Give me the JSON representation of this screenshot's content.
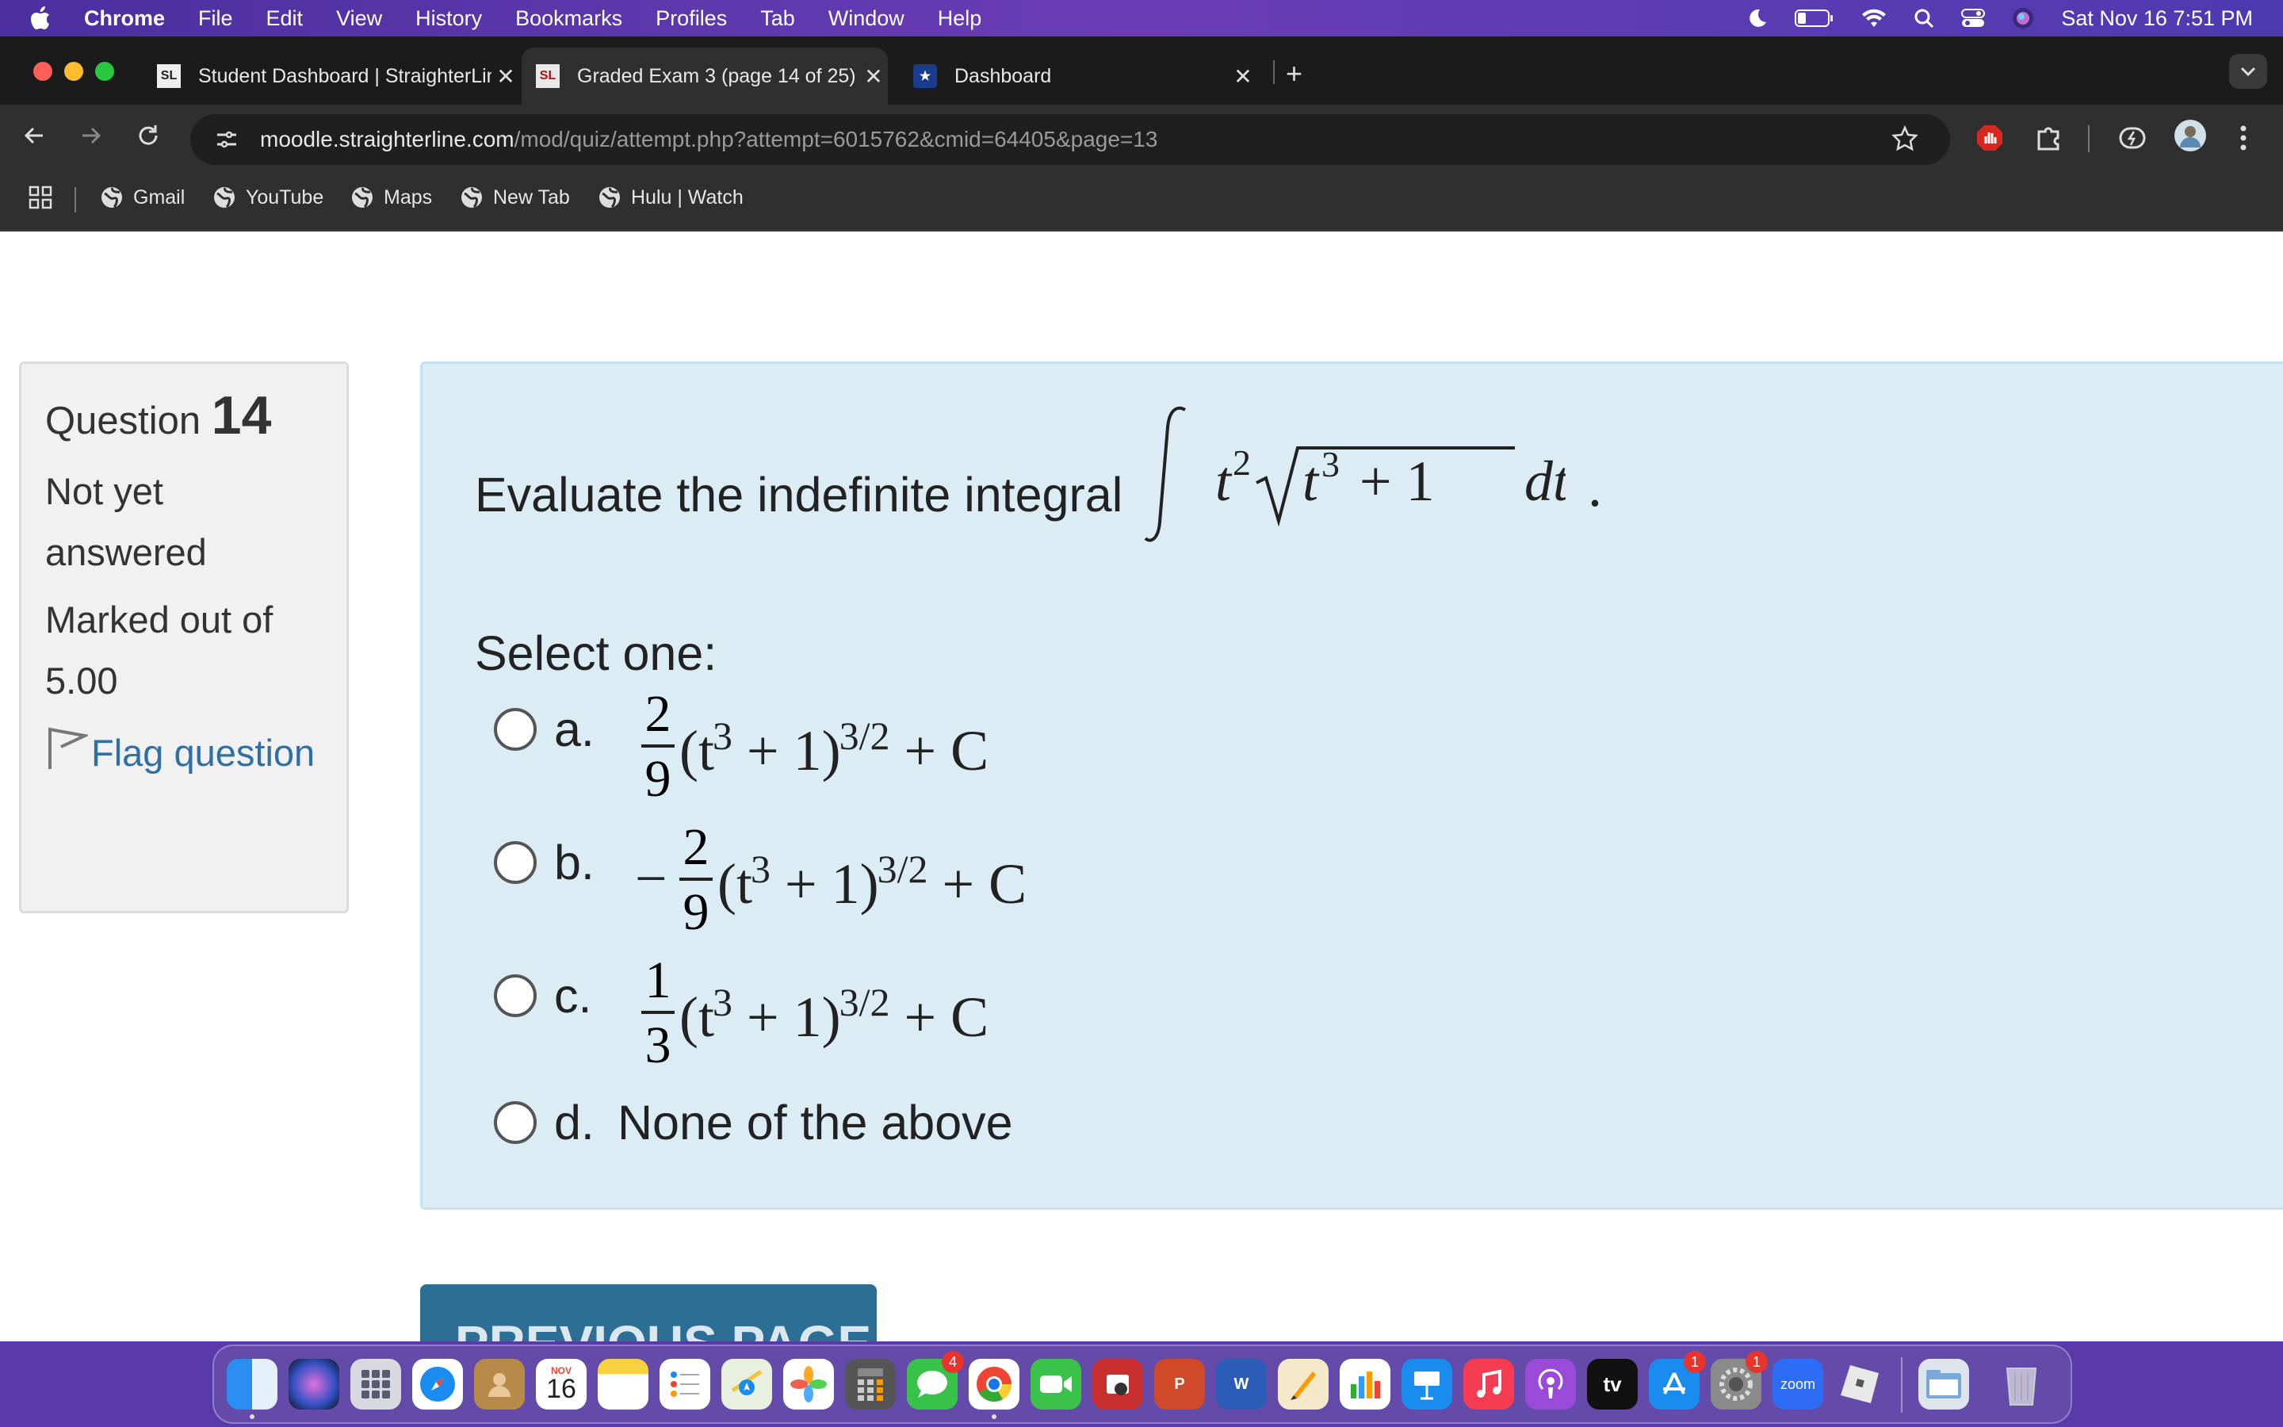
{
  "menubar": {
    "app_name": "Chrome",
    "menus": [
      "File",
      "Edit",
      "View",
      "History",
      "Bookmarks",
      "Profiles",
      "Tab",
      "Window",
      "Help"
    ],
    "datetime": "Sat Nov 16  7:51 PM"
  },
  "tabs": [
    {
      "favicon": "SL",
      "title": "Student Dashboard | StraighterLine",
      "active": false
    },
    {
      "favicon": "SL",
      "title": "Graded Exam 3 (page 14 of 25)",
      "active": true
    },
    {
      "favicon": "★",
      "title": "Dashboard",
      "active": false
    }
  ],
  "address_bar": {
    "domain": "moodle.straighterline.com",
    "path": "/mod/quiz/attempt.php?attempt=6015762&cmid=64405&page=13"
  },
  "bookmarks": [
    "Gmail",
    "YouTube",
    "Maps",
    "New Tab",
    "Hulu | Watch"
  ],
  "question_info": {
    "label": "Question",
    "number": "14",
    "state": "Not yet answered",
    "marks": "Marked out of 5.00",
    "flag_label": "Flag question"
  },
  "question": {
    "prompt": "Evaluate the indefinite integral",
    "integrand": {
      "t_exp": "2",
      "root_var": "t",
      "root_exp": "3",
      "root_rest": "+ 1",
      "diff": "dt",
      "end": "."
    },
    "select_label": "Select one:",
    "options": [
      {
        "letter": "a.",
        "sign": "",
        "num": "2",
        "den": "9",
        "body": "(t",
        "exp1": "3",
        "mid": " + 1)",
        "exp2": "3/2",
        "tail": " + C"
      },
      {
        "letter": "b.",
        "sign": "−",
        "num": "2",
        "den": "9",
        "body": "(t",
        "exp1": "3",
        "mid": " + 1)",
        "exp2": "3/2",
        "tail": " + C"
      },
      {
        "letter": "c.",
        "sign": "",
        "num": "1",
        "den": "3",
        "body": "(t",
        "exp1": "3",
        "mid": " + 1)",
        "exp2": "3/2",
        "tail": " + C"
      },
      {
        "letter": "d.",
        "text": "None of the above"
      }
    ]
  },
  "nav_button": "PREVIOUS PAGE",
  "dock": {
    "calendar_month": "NOV",
    "calendar_day": "16",
    "messages_badge": "4",
    "appstore_badge": "1",
    "settings_badge": "1",
    "zoom_label": "zoom",
    "tv_label": "tv"
  }
}
